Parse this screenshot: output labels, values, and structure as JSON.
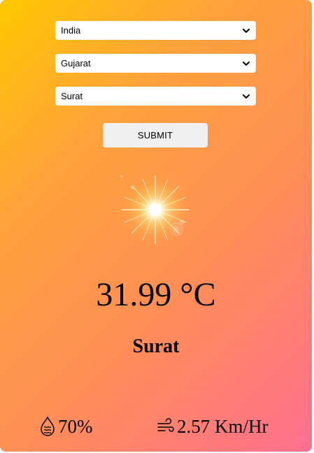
{
  "form": {
    "country": {
      "selected": "India"
    },
    "state": {
      "selected": "Gujarat"
    },
    "city": {
      "selected": "Surat"
    },
    "submit_label": "SUBMIT"
  },
  "weather": {
    "icon": "sun-icon",
    "temperature": "31.99 °C",
    "location": "Surat",
    "humidity": {
      "icon": "humidity-drop-icon",
      "value": "70%"
    },
    "wind": {
      "icon": "wind-icon",
      "value": "2.57 Km/Hr"
    }
  },
  "colors": {
    "gradient_start": "#ffc800",
    "gradient_end": "#ff6f8f",
    "button_bg": "#efefef"
  }
}
